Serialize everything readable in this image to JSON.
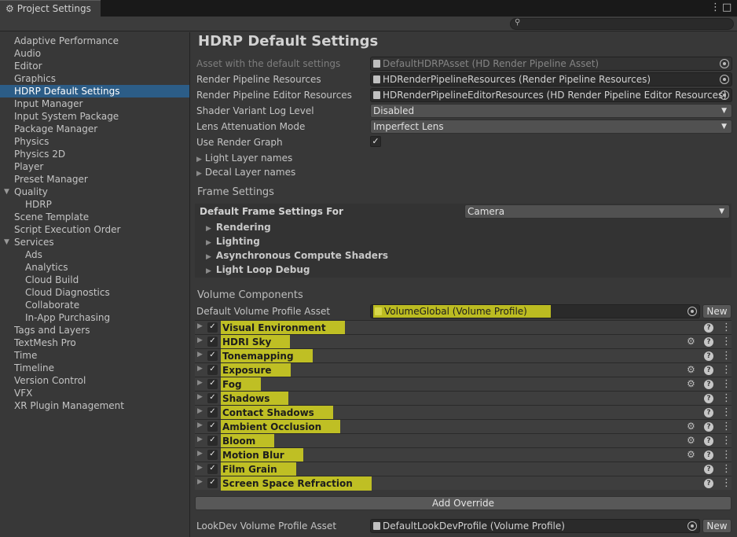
{
  "window": {
    "tab_title": "Project Settings",
    "menu_icon": "⋮",
    "maximize_icon": "□",
    "close_icon": "✕"
  },
  "sidebar": {
    "items": [
      {
        "label": "Adaptive Performance"
      },
      {
        "label": "Audio"
      },
      {
        "label": "Editor"
      },
      {
        "label": "Graphics"
      },
      {
        "label": "HDRP Default Settings",
        "selected": true
      },
      {
        "label": "Input Manager"
      },
      {
        "label": "Input System Package"
      },
      {
        "label": "Package Manager"
      },
      {
        "label": "Physics"
      },
      {
        "label": "Physics 2D"
      },
      {
        "label": "Player"
      },
      {
        "label": "Preset Manager"
      },
      {
        "label": "Quality",
        "expanded": true
      },
      {
        "label": "HDRP",
        "child": true
      },
      {
        "label": "Scene Template"
      },
      {
        "label": "Script Execution Order"
      },
      {
        "label": "Services",
        "expanded": true
      },
      {
        "label": "Ads",
        "child": true
      },
      {
        "label": "Analytics",
        "child": true
      },
      {
        "label": "Cloud Build",
        "child": true
      },
      {
        "label": "Cloud Diagnostics",
        "child": true
      },
      {
        "label": "Collaborate",
        "child": true
      },
      {
        "label": "In-App Purchasing",
        "child": true
      },
      {
        "label": "Tags and Layers"
      },
      {
        "label": "TextMesh Pro"
      },
      {
        "label": "Time"
      },
      {
        "label": "Timeline"
      },
      {
        "label": "Version Control"
      },
      {
        "label": "VFX"
      },
      {
        "label": "XR Plugin Management"
      }
    ]
  },
  "main": {
    "title": "HDRP Default Settings",
    "asset_label": "Asset with the default settings",
    "asset_value": "DefaultHDRPAsset (HD Render Pipeline Asset)",
    "rp_resources_label": "Render Pipeline Resources",
    "rp_resources_value": "HDRenderPipelineResources (Render Pipeline Resources)",
    "rp_editor_resources_label": "Render Pipeline Editor Resources",
    "rp_editor_resources_value": "HDRenderPipelineEditorResources (HD Render Pipeline Editor Resources)",
    "shader_log_label": "Shader Variant Log Level",
    "shader_log_value": "Disabled",
    "lens_label": "Lens Attenuation Mode",
    "lens_value": "Imperfect Lens",
    "render_graph_label": "Use Render Graph",
    "render_graph_checked": true,
    "light_layer_names": "Light Layer names",
    "decal_layer_names": "Decal Layer names"
  },
  "frame_settings": {
    "section_title": "Frame Settings",
    "default_for_label": "Default Frame Settings For",
    "default_for_value": "Camera",
    "groups": [
      "Rendering",
      "Lighting",
      "Asynchronous Compute Shaders",
      "Light Loop Debug"
    ]
  },
  "volume": {
    "section_title": "Volume Components",
    "profile_label": "Default Volume Profile Asset",
    "profile_value": "VolumeGlobal (Volume Profile)",
    "new_label": "New",
    "components": [
      {
        "label": "Visual Environment",
        "advanced": false
      },
      {
        "label": "HDRI Sky",
        "advanced": true
      },
      {
        "label": "Tonemapping",
        "advanced": false
      },
      {
        "label": "Exposure",
        "advanced": true
      },
      {
        "label": "Fog",
        "advanced": true
      },
      {
        "label": "Shadows",
        "advanced": false
      },
      {
        "label": "Contact Shadows",
        "advanced": false
      },
      {
        "label": "Ambient Occlusion",
        "advanced": true
      },
      {
        "label": "Bloom",
        "advanced": true
      },
      {
        "label": "Motion Blur",
        "advanced": true
      },
      {
        "label": "Film Grain",
        "advanced": false
      },
      {
        "label": "Screen Space Refraction",
        "advanced": false
      }
    ],
    "add_override_label": "Add Override",
    "lookdev_label": "LookDev Volume Profile Asset",
    "lookdev_value": "DefaultLookDevProfile (Volume Profile)",
    "lookdev_new_label": "New"
  },
  "colors": {
    "highlight": "#d6d620",
    "selection": "#2c5d87"
  }
}
